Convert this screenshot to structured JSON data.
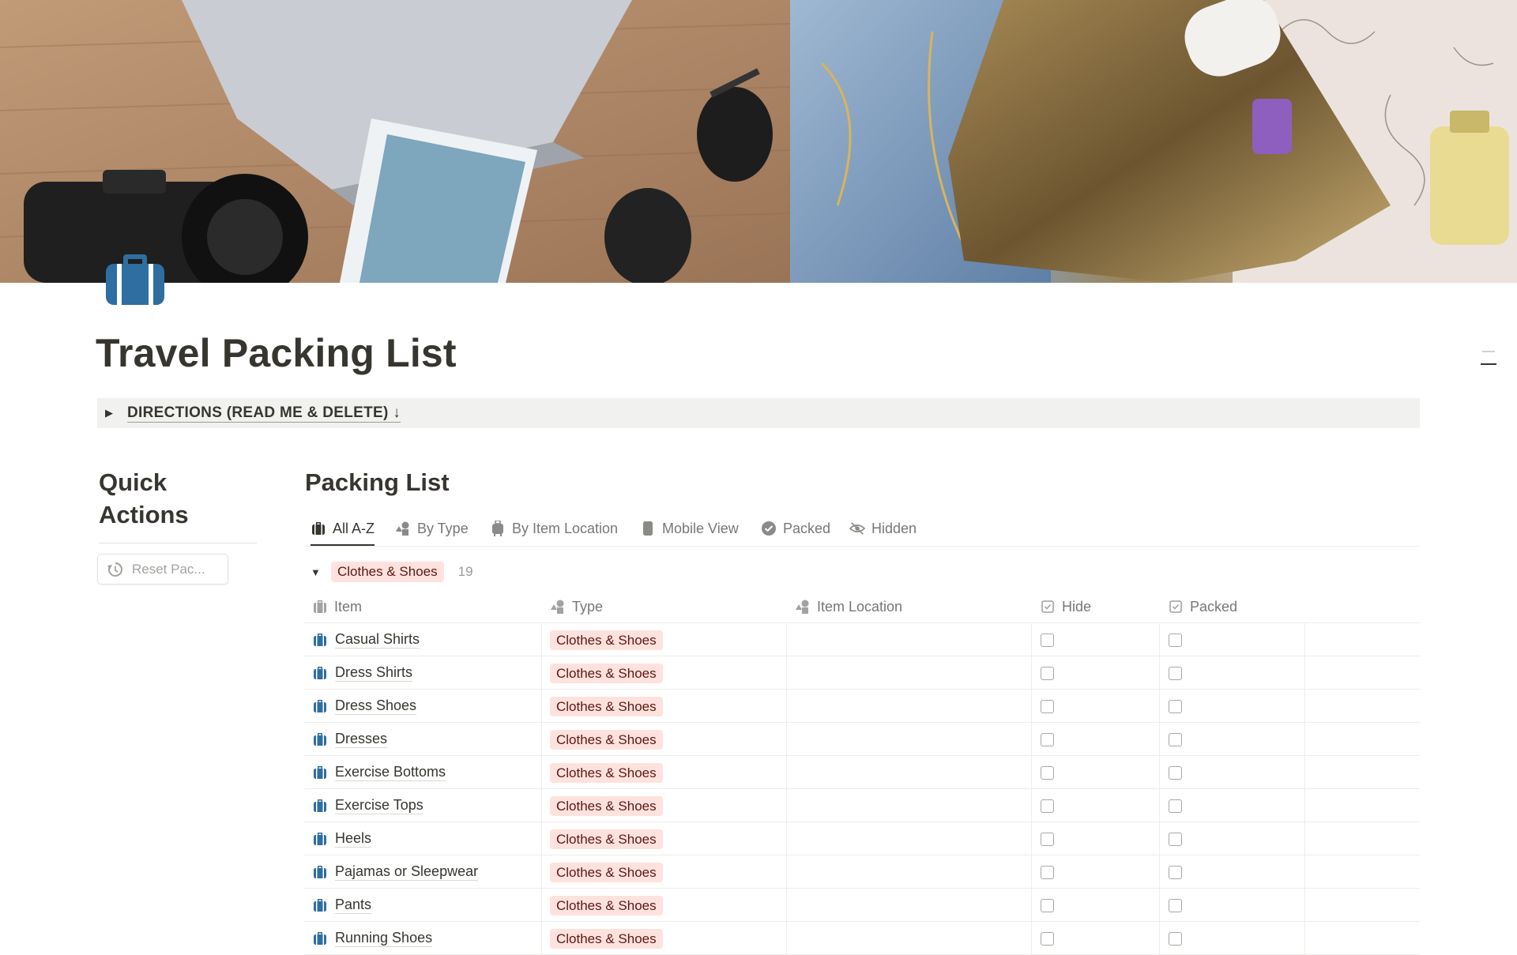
{
  "page": {
    "title": "Travel Packing List",
    "icon": "suitcase-icon",
    "accent_color": "#2e6ea1",
    "cover": "travel-flatlay-photo"
  },
  "directions": {
    "label": "DIRECTIONS (READ ME & DELETE) ↓"
  },
  "quick_actions": {
    "title": "Quick Actions",
    "reset_button": "Reset Pac..."
  },
  "database": {
    "title": "Packing List",
    "tabs": [
      {
        "label": "All A-Z",
        "icon": "suitcase-icon",
        "active": true
      },
      {
        "label": "By Type",
        "icon": "shapes-icon",
        "active": false
      },
      {
        "label": "By Item Location",
        "icon": "luggage-icon",
        "active": false
      },
      {
        "label": "Mobile View",
        "icon": "phone-icon",
        "active": false
      },
      {
        "label": "Packed",
        "icon": "check-circle-icon",
        "active": false
      },
      {
        "label": "Hidden",
        "icon": "eye-slash-icon",
        "active": false
      }
    ],
    "group": {
      "label": "Clothes & Shoes",
      "count": "19",
      "tag_color": "#ffe2dd"
    },
    "columns": {
      "item": "Item",
      "type": "Type",
      "location": "Item Location",
      "hide": "Hide",
      "packed": "Packed"
    },
    "rows": [
      {
        "item": "Casual Shirts",
        "type": "Clothes & Shoes",
        "location": "",
        "hide": false,
        "packed": false
      },
      {
        "item": "Dress Shirts",
        "type": "Clothes & Shoes",
        "location": "",
        "hide": false,
        "packed": false
      },
      {
        "item": "Dress Shoes",
        "type": "Clothes & Shoes",
        "location": "",
        "hide": false,
        "packed": false
      },
      {
        "item": "Dresses",
        "type": "Clothes & Shoes",
        "location": "",
        "hide": false,
        "packed": false
      },
      {
        "item": "Exercise Bottoms",
        "type": "Clothes & Shoes",
        "location": "",
        "hide": false,
        "packed": false
      },
      {
        "item": "Exercise Tops",
        "type": "Clothes & Shoes",
        "location": "",
        "hide": false,
        "packed": false
      },
      {
        "item": "Heels",
        "type": "Clothes & Shoes",
        "location": "",
        "hide": false,
        "packed": false
      },
      {
        "item": "Pajamas or Sleepwear",
        "type": "Clothes & Shoes",
        "location": "",
        "hide": false,
        "packed": false
      },
      {
        "item": "Pants",
        "type": "Clothes & Shoes",
        "location": "",
        "hide": false,
        "packed": false
      },
      {
        "item": "Running Shoes",
        "type": "Clothes & Shoes",
        "location": "",
        "hide": false,
        "packed": false
      }
    ]
  }
}
